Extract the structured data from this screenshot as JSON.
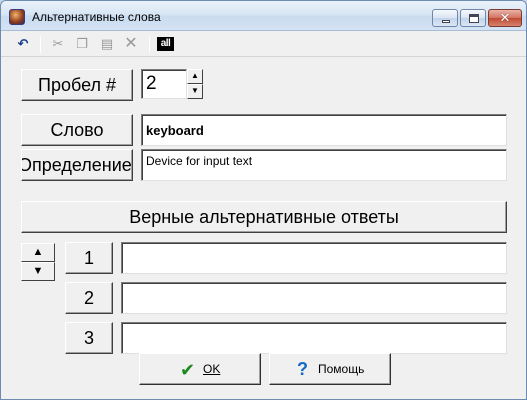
{
  "window": {
    "title": "Альтернативные слова"
  },
  "toolbar": {
    "undo_icon": "undo-icon",
    "cut_icon": "scissors-icon",
    "copy_icon": "copy-icon",
    "paste_icon": "paste-icon",
    "delete_icon": "x-icon",
    "select_all_label": "all"
  },
  "form": {
    "space_label": "Пробел #",
    "space_value": "2",
    "word_label": "Слово",
    "word_value": "keyboard",
    "definition_label": "Определение",
    "definition_value": "Device for input text"
  },
  "alternatives": {
    "header": "Верные альтернативные ответы",
    "rows": [
      {
        "number": "1",
        "value": ""
      },
      {
        "number": "2",
        "value": ""
      },
      {
        "number": "3",
        "value": ""
      }
    ]
  },
  "buttons": {
    "ok_label": "OK",
    "help_label": "Помощь"
  }
}
